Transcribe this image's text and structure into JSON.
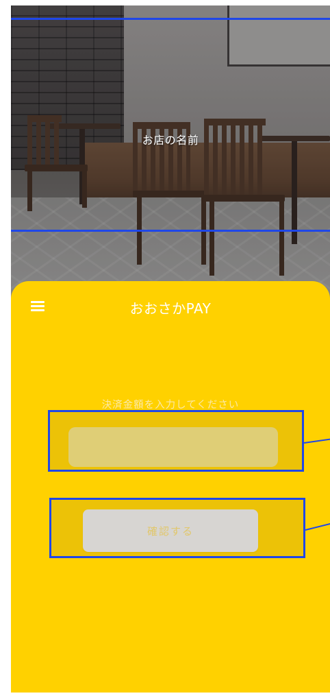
{
  "store": {
    "name": "お店の名前"
  },
  "app": {
    "title": "おおさかPAY",
    "menu_icon": "hamburger-menu-icon"
  },
  "payment": {
    "amount_label": "決済金額を入力してください",
    "amount_value": "",
    "amount_placeholder": "",
    "confirm_label": "確認する"
  },
  "colors": {
    "panel_background": "#ffd100",
    "input_background": "#f0e088",
    "button_background": "#e6e8f8",
    "button_text": "#f2d77a",
    "annotation_outline": "#1f47e8"
  }
}
